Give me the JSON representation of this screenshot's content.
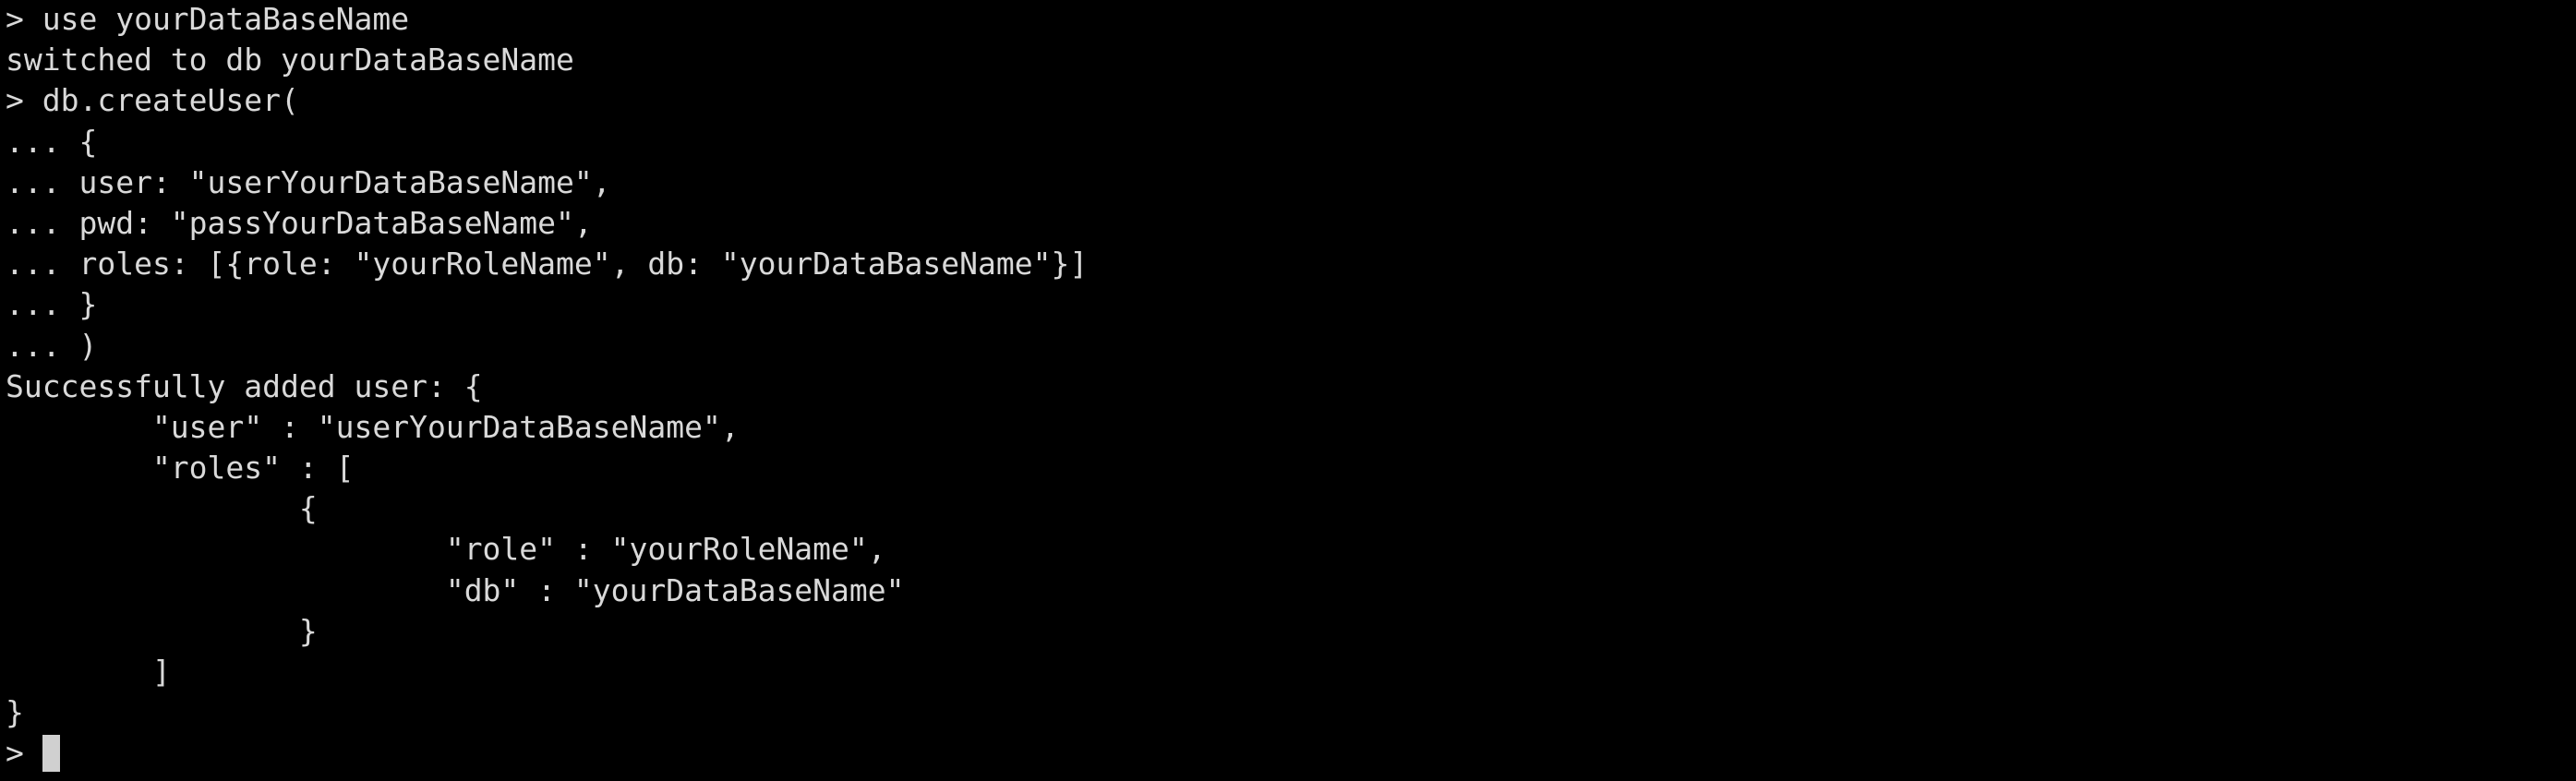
{
  "colors": {
    "background": "#000000",
    "text": "#d9d9d9",
    "cursor": "#d0d0d0"
  },
  "terminal": {
    "lines": [
      "> use yourDataBaseName",
      "switched to db yourDataBaseName",
      "> db.createUser(",
      "... {",
      "... user: \"userYourDataBaseName\",",
      "... pwd: \"passYourDataBaseName\",",
      "... roles: [{role: \"yourRoleName\", db: \"yourDataBaseName\"}]",
      "... }",
      "... )",
      "Successfully added user: {",
      "        \"user\" : \"userYourDataBaseName\",",
      "        \"roles\" : [",
      "                {",
      "                        \"role\" : \"yourRoleName\",",
      "                        \"db\" : \"yourDataBaseName\"",
      "                }",
      "        ]",
      "}"
    ],
    "prompt": ">"
  }
}
